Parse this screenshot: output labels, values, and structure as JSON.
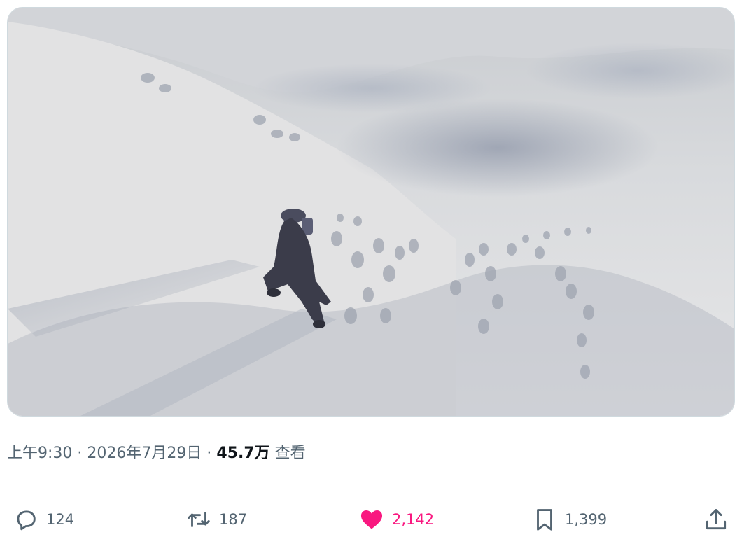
{
  "tweet": {
    "media": {
      "kind": "video-frame"
    },
    "meta": {
      "time": "上午9:30",
      "separator": "·",
      "date": "2026年7月29日",
      "views_count": "45.7万",
      "views_label": "查看"
    },
    "actions": {
      "reply": {
        "count": "124",
        "icon": "reply-icon"
      },
      "retweet": {
        "count": "187",
        "icon": "retweet-icon"
      },
      "like": {
        "count": "2,142",
        "icon": "heart-icon",
        "active": true,
        "color": "#f91880"
      },
      "bookmark": {
        "count": "1,399",
        "icon": "bookmark-icon"
      },
      "share": {
        "icon": "share-icon"
      }
    }
  }
}
